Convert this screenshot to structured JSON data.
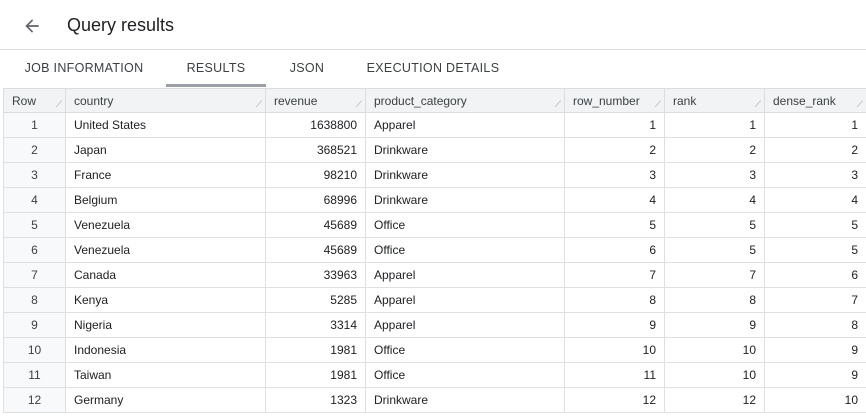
{
  "header": {
    "title": "Query results",
    "back_icon": "arrow-left-icon"
  },
  "tabs": [
    {
      "label": "JOB INFORMATION",
      "active": false
    },
    {
      "label": "RESULTS",
      "active": true
    },
    {
      "label": "JSON",
      "active": false
    },
    {
      "label": "EXECUTION DETAILS",
      "active": false
    }
  ],
  "table": {
    "columns": [
      "Row",
      "country",
      "revenue",
      "product_category",
      "row_number",
      "rank",
      "dense_rank"
    ],
    "rows": [
      [
        "1",
        "United States",
        "1638800",
        "Apparel",
        "1",
        "1",
        "1"
      ],
      [
        "2",
        "Japan",
        "368521",
        "Drinkware",
        "2",
        "2",
        "2"
      ],
      [
        "3",
        "France",
        "98210",
        "Drinkware",
        "3",
        "3",
        "3"
      ],
      [
        "4",
        "Belgium",
        "68996",
        "Drinkware",
        "4",
        "4",
        "4"
      ],
      [
        "5",
        "Venezuela",
        "45689",
        "Office",
        "5",
        "5",
        "5"
      ],
      [
        "6",
        "Venezuela",
        "45689",
        "Office",
        "6",
        "5",
        "5"
      ],
      [
        "7",
        "Canada",
        "33963",
        "Apparel",
        "7",
        "7",
        "6"
      ],
      [
        "8",
        "Kenya",
        "5285",
        "Apparel",
        "8",
        "8",
        "7"
      ],
      [
        "9",
        "Nigeria",
        "3314",
        "Apparel",
        "9",
        "9",
        "8"
      ],
      [
        "10",
        "Indonesia",
        "1981",
        "Office",
        "10",
        "10",
        "9"
      ],
      [
        "11",
        "Taiwan",
        "1981",
        "Office",
        "11",
        "10",
        "9"
      ],
      [
        "12",
        "Germany",
        "1323",
        "Drinkware",
        "12",
        "12",
        "10"
      ]
    ]
  }
}
